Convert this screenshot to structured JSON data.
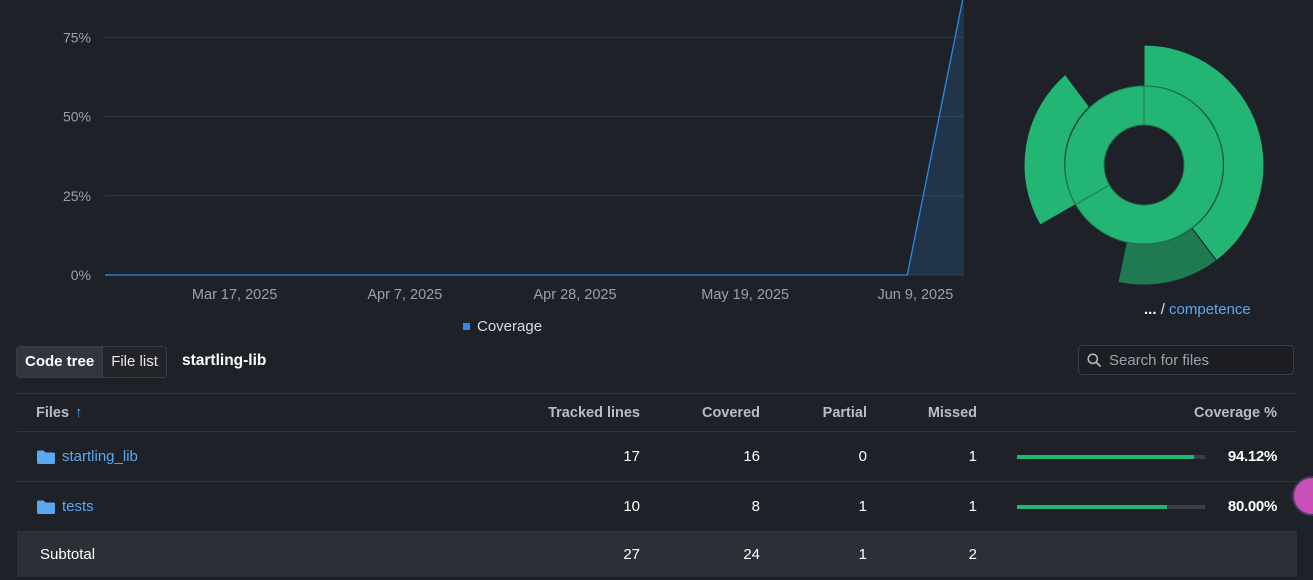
{
  "chart_data": {
    "type": "area",
    "y_ticks": [
      "0%",
      "25%",
      "50%",
      "75%"
    ],
    "x_ticks": [
      "Mar 17, 2025",
      "Apr 7, 2025",
      "Apr 28, 2025",
      "May 19, 2025",
      "Jun 9, 2025"
    ],
    "series": [
      {
        "name": "Coverage",
        "color": "#2b8bea",
        "points": [
          {
            "x": "2025-03-01",
            "y": 0
          },
          {
            "x": "2025-06-08",
            "y": 0
          },
          {
            "x": "2025-06-15",
            "y": 88.9
          }
        ]
      }
    ],
    "ylim": [
      0,
      100
    ],
    "grid": true,
    "legend": "bottom-center"
  },
  "legend": {
    "label": "Coverage"
  },
  "sunburst": {
    "breadcrumb_ellipsis": "...",
    "breadcrumb_sep": "/",
    "breadcrumb_link": "competence",
    "colors": {
      "high": "#22b573",
      "mid": "#1f7a51"
    }
  },
  "controls": {
    "tab_code_tree": "Code tree",
    "tab_file_list": "File list",
    "repo_name": "startling-lib",
    "search_placeholder": "Search for files"
  },
  "table": {
    "headers": {
      "files": "Files",
      "tracked": "Tracked lines",
      "covered": "Covered",
      "partial": "Partial",
      "missed": "Missed",
      "coverage": "Coverage %"
    },
    "rows": [
      {
        "name": "startling_lib",
        "tracked": "17",
        "covered": "16",
        "partial": "0",
        "missed": "1",
        "coverage": "94.12%",
        "coverage_fraction": 0.9412
      },
      {
        "name": "tests",
        "tracked": "10",
        "covered": "8",
        "partial": "1",
        "missed": "1",
        "coverage": "80.00%",
        "coverage_fraction": 0.8
      }
    ],
    "subtotal": {
      "label": "Subtotal",
      "tracked": "27",
      "covered": "24",
      "partial": "1",
      "missed": "2"
    }
  }
}
